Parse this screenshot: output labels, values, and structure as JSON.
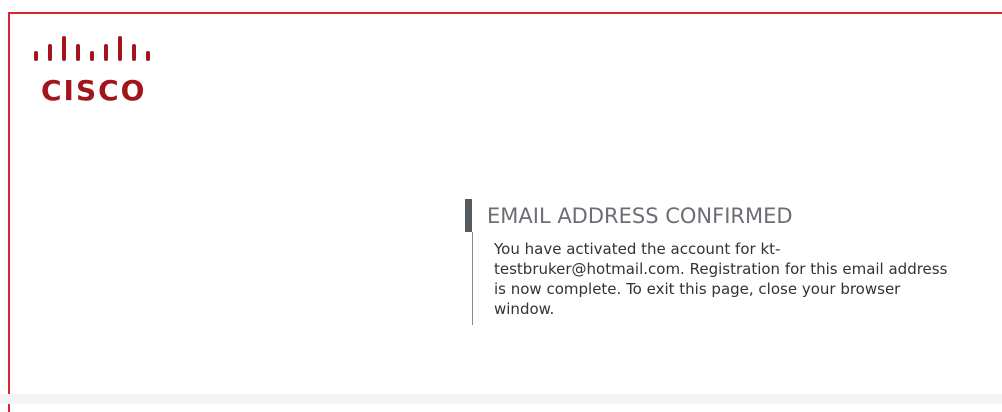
{
  "brand": {
    "name": "CISCO",
    "color": "#a2151b"
  },
  "frame": {
    "border_color": "#d6262f"
  },
  "confirmation": {
    "heading": "EMAIL ADDRESS CONFIRMED",
    "message": "You have activated the account for kt-testbruker@hotmail.com. Registration for this email address is now complete. To exit this page, close your browser window."
  }
}
